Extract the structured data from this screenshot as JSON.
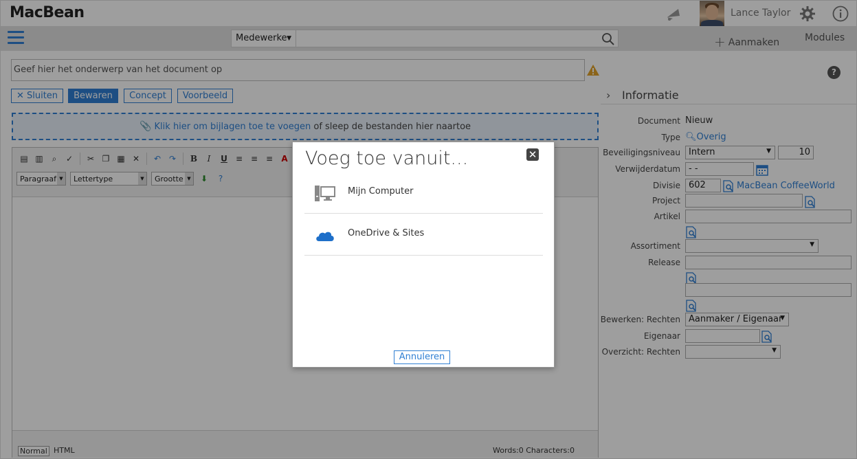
{
  "header": {
    "logo": "MacBean",
    "username": "Lance Taylor"
  },
  "navbar": {
    "search_category": "Medewerke",
    "search_value": "",
    "create_label": "Aanmaken",
    "modules_label": "Modules"
  },
  "document": {
    "subject_placeholder": "Geef hier het onderwerp van het document op",
    "buttons": {
      "close": "Sluiten",
      "save": "Bewaren",
      "concept": "Concept",
      "preview": "Voorbeeld"
    },
    "dropzone": {
      "link": "Klik hier om bijlagen toe te voegen",
      "rest": "of sleep de bestanden hier naartoe"
    },
    "editor": {
      "paragraph": "Paragraaf",
      "font": "Lettertype",
      "size": "Grootte",
      "mode_normal": "Normal",
      "mode_html": "HTML",
      "counts": "Words:0 Characters:0"
    }
  },
  "panel": {
    "title": "Informatie",
    "document_label": "Document",
    "document_value": "Nieuw",
    "type_label": "Type",
    "type_value": "Overig",
    "security_label": "Beveiligingsniveau",
    "security_value": "Intern",
    "security_level": "10",
    "delete_label": "Verwijderdatum",
    "delete_value": "- -",
    "division_label": "Divisie",
    "division_code": "602",
    "division_name": "MacBean CoffeeWorld",
    "project_label": "Project",
    "article_label": "Artikel",
    "assortment_label": "Assortiment",
    "release_label": "Release",
    "edit_rights_label": "Bewerken: Rechten",
    "edit_rights_value": "Aanmaker / Eigenaar",
    "owner_label": "Eigenaar",
    "overview_rights_label": "Overzicht: Rechten"
  },
  "dialog": {
    "title": "Voeg toe vanuit...",
    "options": [
      {
        "label": "Mijn Computer",
        "icon": "computer-icon"
      },
      {
        "label": "OneDrive & Sites",
        "icon": "cloud-icon"
      }
    ],
    "cancel": "Annuleren"
  },
  "colors": {
    "accent": "#2f7fd3",
    "warning": "#e0a22a"
  }
}
